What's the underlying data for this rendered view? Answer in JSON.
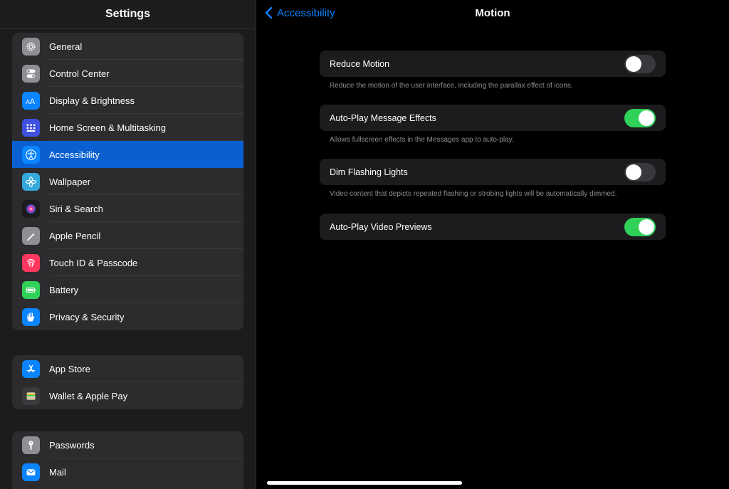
{
  "sidebar": {
    "title": "Settings",
    "groups": [
      {
        "items": [
          {
            "label": "General",
            "icon": "gear-icon",
            "color": "#8e8e93"
          },
          {
            "label": "Control Center",
            "icon": "switches-icon",
            "color": "#8e8e93"
          },
          {
            "label": "Display & Brightness",
            "icon": "text-size-icon",
            "color": "#0a84ff"
          },
          {
            "label": "Home Screen & Multitasking",
            "icon": "grid-icon",
            "color": "#3f51e0"
          },
          {
            "label": "Accessibility",
            "icon": "accessibility-icon",
            "color": "#0a84ff",
            "selected": true
          },
          {
            "label": "Wallpaper",
            "icon": "flower-icon",
            "color": "#35aadc"
          },
          {
            "label": "Siri & Search",
            "icon": "siri-icon",
            "color": "#1c1c1e"
          },
          {
            "label": "Apple Pencil",
            "icon": "pencil-icon",
            "color": "#8e8e93"
          },
          {
            "label": "Touch ID & Passcode",
            "icon": "fingerprint-icon",
            "color": "#ff375f"
          },
          {
            "label": "Battery",
            "icon": "battery-icon",
            "color": "#30d158"
          },
          {
            "label": "Privacy & Security",
            "icon": "hand-icon",
            "color": "#0a84ff"
          }
        ]
      },
      {
        "items": [
          {
            "label": "App Store",
            "icon": "app-store-icon",
            "color": "#0a84ff"
          },
          {
            "label": "Wallet & Apple Pay",
            "icon": "wallet-icon",
            "color": "#3a3a3c"
          }
        ]
      },
      {
        "items": [
          {
            "label": "Passwords",
            "icon": "key-icon",
            "color": "#8e8e93"
          },
          {
            "label": "Mail",
            "icon": "mail-icon",
            "color": "#0a84ff"
          }
        ]
      }
    ]
  },
  "detail": {
    "back_label": "Accessibility",
    "title": "Motion",
    "settings": [
      {
        "label": "Reduce Motion",
        "on": false,
        "footnote": "Reduce the motion of the user interface, including the parallax effect of icons."
      },
      {
        "label": "Auto-Play Message Effects",
        "on": true,
        "footnote": "Allows fullscreen effects in the Messages app to auto-play."
      },
      {
        "label": "Dim Flashing Lights",
        "on": false,
        "footnote": "Video content that depicts repeated flashing or strobing lights will be automatically dimmed."
      },
      {
        "label": "Auto-Play Video Previews",
        "on": true,
        "footnote": ""
      }
    ]
  }
}
